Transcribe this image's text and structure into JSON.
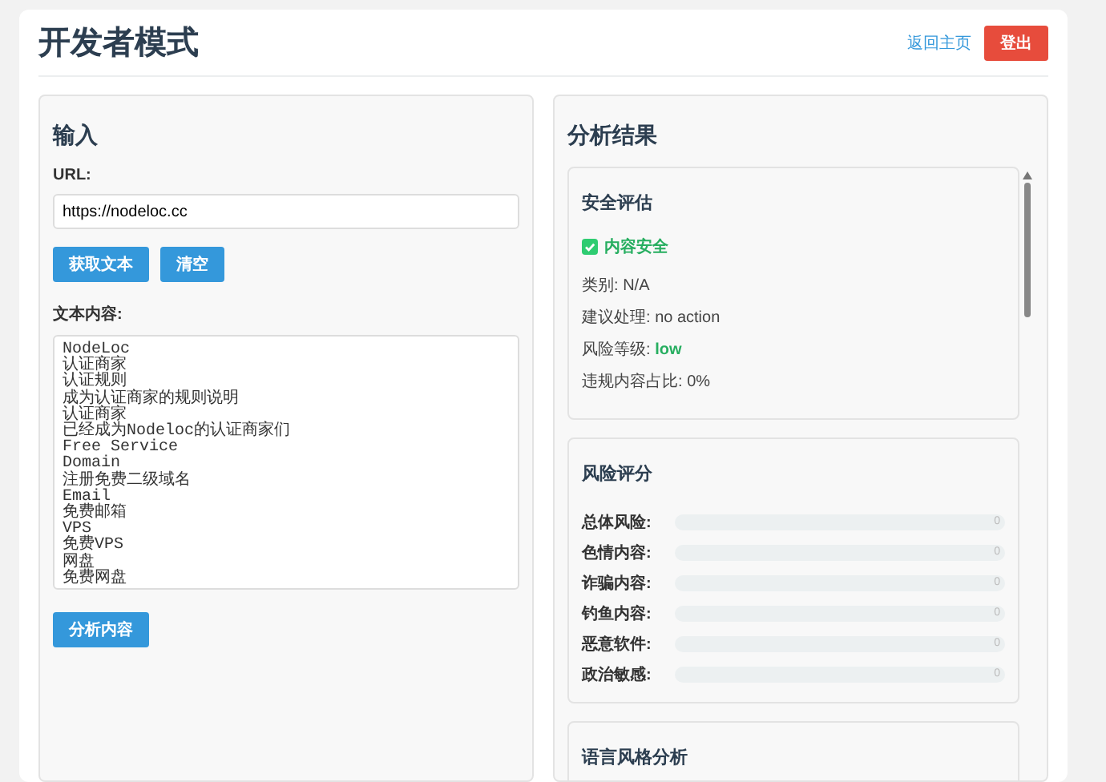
{
  "header": {
    "title": "开发者模式",
    "home_link": "返回主页",
    "logout_button": "登出"
  },
  "input_panel": {
    "heading": "输入",
    "url_label": "URL:",
    "url_value": "https://nodeloc.cc",
    "buttons": [
      "获取文本",
      "清空"
    ],
    "text_label": "文本内容:",
    "text_lines": [
      "NodeLoc",
      "认证商家",
      "认证规则",
      "成为认证商家的规则说明",
      "认证商家",
      "已经成为Nodeloc的认证商家们",
      "Free Service",
      "Domain",
      "注册免费二级域名",
      "Email",
      "免费邮箱",
      "VPS",
      "免费VPS",
      "网盘",
      "免费网盘"
    ],
    "analyze_button": "分析内容"
  },
  "results_panel": {
    "heading": "分析结果",
    "safety": {
      "title": "安全评估",
      "status": {
        "text": "内容安全",
        "safe": true
      },
      "fields": [
        {
          "label": "类别:",
          "value": "N/A",
          "kind": "plain"
        },
        {
          "label": "建议处理:",
          "value": "no action",
          "kind": "plain"
        },
        {
          "label": "风险等级:",
          "value": "low",
          "kind": "level"
        },
        {
          "label": "违规内容占比:",
          "value": "0%",
          "kind": "plain"
        }
      ]
    },
    "risk": {
      "title": "风险评分",
      "rows": [
        {
          "label": "总体风险:",
          "level": 0,
          "reading": "0"
        },
        {
          "label": "色情内容:",
          "level": 0,
          "reading": "0"
        },
        {
          "label": "诈骗内容:",
          "level": 0,
          "reading": "0"
        },
        {
          "label": "钓鱼内容:",
          "level": 0,
          "reading": "0"
        },
        {
          "label": "恶意软件:",
          "level": 0,
          "reading": "0"
        },
        {
          "label": "政治敏感:",
          "level": 0,
          "reading": "0"
        }
      ]
    },
    "style": {
      "title": "语言风格分析"
    }
  }
}
